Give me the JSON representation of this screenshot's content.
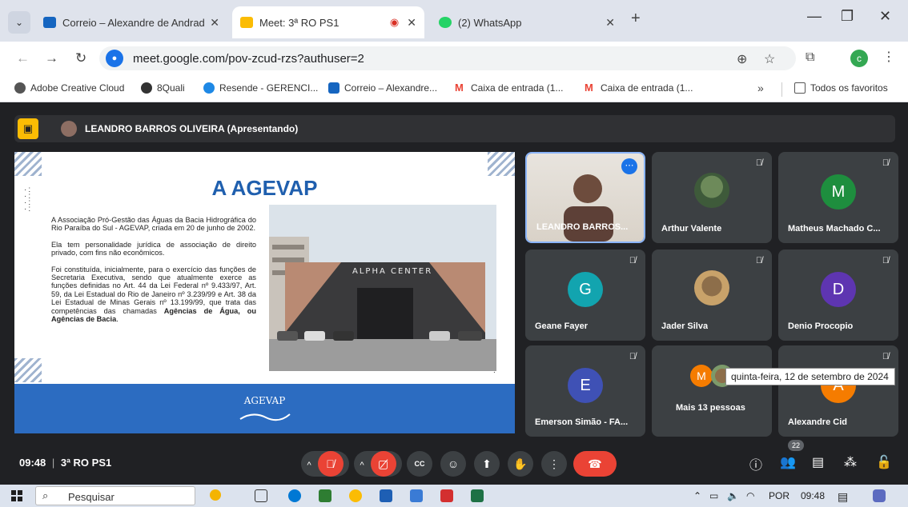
{
  "tabs": [
    {
      "label": "Correio – Alexandre de Andrad",
      "favicon_color": "#1565c0",
      "active": false
    },
    {
      "label": "Meet: 3ª RO PS1",
      "favicon_color": "#fbbc04",
      "active": true
    },
    {
      "label": "(2) WhatsApp",
      "favicon_color": "#25d366",
      "active": false
    }
  ],
  "address": {
    "url": "meet.google.com/pov-zcud-rzs?authuser=2",
    "profile_initial": "c"
  },
  "bookmarks": [
    {
      "label": "Adobe Creative Cloud",
      "color": "#555555"
    },
    {
      "label": "8Quali",
      "color": "#333333"
    },
    {
      "label": "Resende - GERENCI...",
      "color": "#1e88e5"
    },
    {
      "label": "Correio – Alexandre...",
      "color": "#1565c0"
    },
    {
      "label": "Caixa de entrada (1...",
      "color": "#ea4335"
    },
    {
      "label": "Caixa de entrada (1...",
      "color": "#ea4335"
    }
  ],
  "bookmarks_more": "»",
  "bookmarks_all": "Todos os favoritos",
  "presenter": {
    "name": "LEANDRO BARROS OLIVEIRA (Apresentando)"
  },
  "slide": {
    "title": "A AGEVAP",
    "para1": "A Associação Pró-Gestão das Águas da Bacia Hidrográfica do Rio Paraíba do Sul - AGEVAP, criada em 20 de junho de 2002.",
    "para2": "Ela tem personalidade jurídica de associação de direito privado, com fins não econômicos.",
    "para3_plain": "Foi constituída, inicialmente, para o exercício das funções de Secretaria Executiva, sendo que atualmente exerce as funções definidas no Art. 44 da Lei Federal nº 9.433/97, Art. 59, da Lei Estadual do Rio de Janeiro nº 3.239/99 e Art. 38 da Lei Estadual de Minas Gerais nº 13.199/99, que trata das competências das chamadas ",
    "para3_bold": "Agências de Água, ou Agências de Bacia",
    "para3_end": ".",
    "building_sign": "ALPHA CENTER",
    "footer_logo": "AGEVAP"
  },
  "participants": [
    {
      "name": "LEANDRO BARROS...",
      "type": "video",
      "speaking": true
    },
    {
      "name": "Arthur Valente",
      "type": "photo",
      "muted": true
    },
    {
      "name": "Matheus Machado C...",
      "initial": "M",
      "color": "#1e8e3e",
      "muted": true
    },
    {
      "name": "Geane Fayer",
      "initial": "G",
      "color": "#12a4af",
      "muted": true
    },
    {
      "name": "Jader Silva",
      "type": "photo",
      "muted": true
    },
    {
      "name": "Denio Procopio",
      "initial": "D",
      "color": "#5e35b1",
      "muted": true
    },
    {
      "name": "Emerson Simão - FA...",
      "initial": "E",
      "color": "#3f51b5",
      "muted": true
    },
    {
      "name": "Mais 13 pessoas",
      "initial": "M",
      "color": "#f57c00",
      "group": true
    },
    {
      "name": "Alexandre Cid",
      "initial": "A",
      "color": "#f57c00",
      "muted": true
    }
  ],
  "meeting": {
    "time": "09:48",
    "separator": "|",
    "code": "3ª RO PS1"
  },
  "controls": {
    "people_count": "22",
    "captions": "CC"
  },
  "tooltip": "quinta-feira, 12 de setembro de 2024",
  "taskbar": {
    "search_placeholder": "Pesquisar",
    "language": "POR",
    "clock": "09:48"
  }
}
